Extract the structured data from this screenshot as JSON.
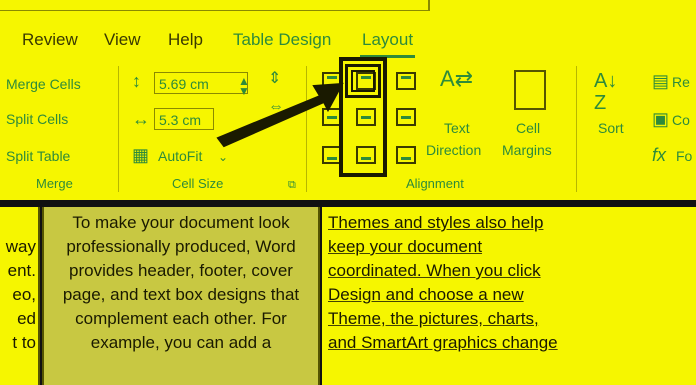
{
  "tabs": [
    {
      "label": "Review"
    },
    {
      "label": "View"
    },
    {
      "label": "Help"
    },
    {
      "label": "Table Design"
    },
    {
      "label": "Layout"
    }
  ],
  "merge_group": {
    "merge_cells": "Merge Cells",
    "split_cells": "Split Cells",
    "split_table": "Split Table",
    "label": "Merge"
  },
  "cell_size_group": {
    "height_value": "5.69 cm",
    "width_value": "5.3 cm",
    "autofit": "AutoFit",
    "label": "Cell Size"
  },
  "alignment_group": {
    "text_direction_1": "Text",
    "text_direction_2": "Direction",
    "cell_margins_1": "Cell",
    "cell_margins_2": "Margins",
    "label": "Alignment"
  },
  "data_group": {
    "sort": "Sort",
    "repeat_partial": "Re",
    "convert_partial": "Co",
    "formula_partial": "Fo"
  },
  "document": {
    "left_lines": [
      "way",
      "ent.",
      "eo,",
      "ed",
      "t to"
    ],
    "mid_lines": [
      "To make your document look",
      "professionally produced, Word",
      "provides header, footer, cover",
      "page, and text box designs that",
      "complement each other. For",
      "example, you can add a"
    ],
    "right_lines": [
      "Themes and styles also help",
      "keep your document",
      "coordinated. When you click",
      "Design and choose a new",
      "Theme, the pictures, charts,",
      "and SmartArt graphics change"
    ]
  }
}
